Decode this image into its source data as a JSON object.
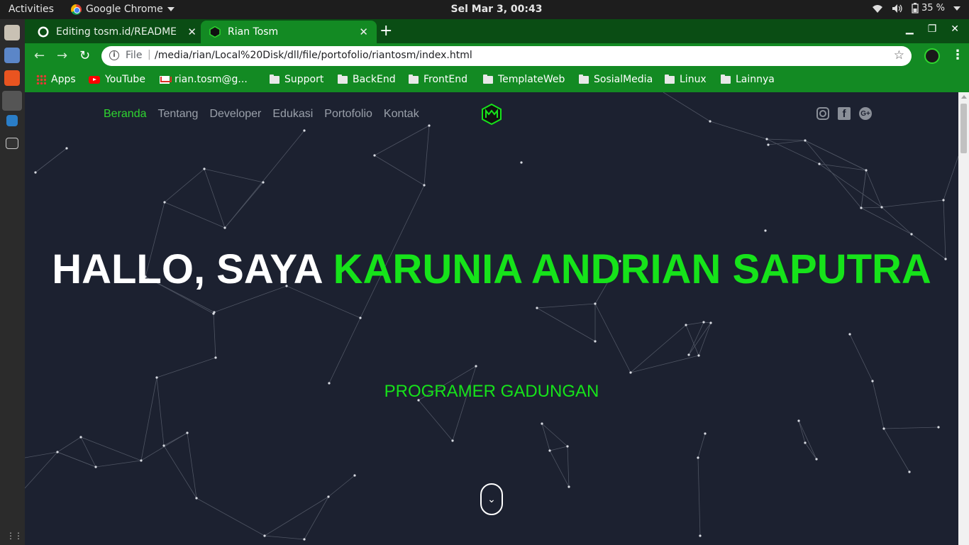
{
  "system": {
    "activities": "Activities",
    "app_name": "Google Chrome",
    "clock": "Sel Mar  3, 00:43",
    "battery": "35 %"
  },
  "browser": {
    "tabs": [
      {
        "title": "Editing tosm.id/README"
      },
      {
        "title": "Rian Tosm"
      }
    ],
    "address": {
      "scheme_label": "File",
      "url": "/media/rian/Local%20Disk/dll/file/portofolio/riantosm/index.html"
    },
    "bookmarks": [
      {
        "label": "Apps"
      },
      {
        "label": "YouTube"
      },
      {
        "label": "rian.tosm@g..."
      },
      {
        "label": "Support"
      },
      {
        "label": "BackEnd"
      },
      {
        "label": "FrontEnd"
      },
      {
        "label": "TemplateWeb"
      },
      {
        "label": "SosialMedia"
      },
      {
        "label": "Linux"
      },
      {
        "label": "Lainnya"
      }
    ]
  },
  "site": {
    "nav": [
      "Beranda",
      "Tentang",
      "Developer",
      "Edukasi",
      "Portofolio",
      "Kontak"
    ],
    "social_icons": [
      "instagram-icon",
      "facebook-icon",
      "google-plus-icon"
    ],
    "hero": {
      "greeting": "HALLO, SAYA",
      "name": "KARUNIA ANDRIAN SAPUTRA",
      "subtitle": "PROGRAMER GADUNGAN"
    },
    "colors": {
      "accent": "#16e31a",
      "background": "#1c2130",
      "chrome_theme": "#138a23"
    }
  }
}
